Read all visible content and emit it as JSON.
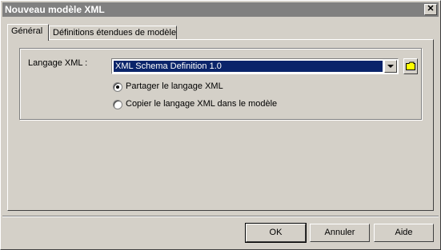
{
  "window": {
    "title": "Nouveau modèle XML",
    "close_label": "✕"
  },
  "tabs": [
    {
      "label": "Général",
      "active": true
    },
    {
      "label": "Définitions étendues de modèle",
      "active": false
    }
  ],
  "form": {
    "language_label": "Langage XML :",
    "language_value": "XML Schema Definition 1.0",
    "radios": [
      {
        "label": "Partager le langage XML",
        "checked": true
      },
      {
        "label": "Copier le langage XML dans le modèle",
        "checked": false
      }
    ]
  },
  "buttons": {
    "ok": "OK",
    "cancel": "Annuler",
    "help": "Aide"
  },
  "icons": {
    "folder": "folder-icon",
    "dropdown": "chevron-down-icon",
    "close": "close-icon"
  },
  "colors": {
    "selection": "#0a246a",
    "titlebar": "#808080",
    "face": "#d4d0c8"
  }
}
